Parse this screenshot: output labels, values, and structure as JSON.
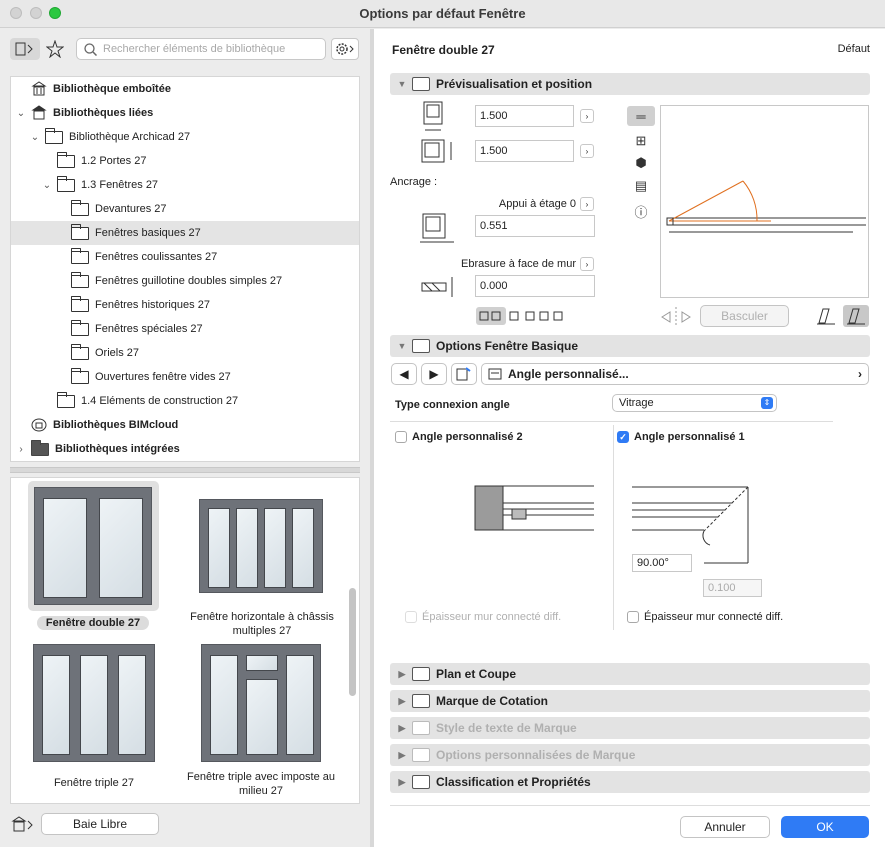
{
  "window": {
    "title": "Options par défaut Fenêtre"
  },
  "left": {
    "search_placeholder": "Rechercher éléments de bibliothèque",
    "tree": [
      {
        "label": "Bibliothèque emboîtée",
        "bold": true
      },
      {
        "label": "Bibliothèques liées",
        "bold": true
      },
      {
        "label": "Bibliothèque Archicad 27"
      },
      {
        "label": "1.2 Portes 27"
      },
      {
        "label": "1.3 Fenêtres 27"
      },
      {
        "label": "Devantures 27"
      },
      {
        "label": "Fenêtres basiques 27"
      },
      {
        "label": "Fenêtres coulissantes 27"
      },
      {
        "label": "Fenêtres guillotine doubles simples 27"
      },
      {
        "label": "Fenêtres historiques 27"
      },
      {
        "label": "Fenêtres spéciales 27"
      },
      {
        "label": "Oriels 27"
      },
      {
        "label": "Ouvertures fenêtre vides 27"
      },
      {
        "label": "1.4 Eléments de construction 27"
      },
      {
        "label": "Bibliothèques BIMcloud",
        "bold": true
      },
      {
        "label": "Bibliothèques intégrées",
        "bold": true
      }
    ],
    "gallery": [
      {
        "name": "Fenêtre double 27"
      },
      {
        "name": "Fenêtre horizontale à châssis multiples 27"
      },
      {
        "name": "Fenêtre triple 27"
      },
      {
        "name": "Fenêtre triple avec imposte au milieu 27"
      }
    ],
    "bottom_button": "Baie Libre"
  },
  "right": {
    "object_name": "Fenêtre double 27",
    "default_label": "Défaut",
    "preview_section": "Prévisualisation et position",
    "width_value": "1.500",
    "height_value": "1.500",
    "anchor_label": "Ancrage :",
    "sill_label": "Appui à étage 0",
    "sill_value": "0.551",
    "reveal_label": "Ebrasure à face de mur",
    "reveal_value": "0.000",
    "flip_button": "Basculer",
    "options_section": "Options Fenêtre Basique",
    "page_select": "Angle personnalisé...",
    "corner_type_label": "Type connexion angle",
    "corner_type_value": "Vitrage",
    "angle2_label": "Angle personnalisé 2",
    "angle1_label": "Angle personnalisé 1",
    "angle1_checked": true,
    "angle_value": "90.00°",
    "offset_value": "0.100",
    "thickness_left": "Épaisseur mur connecté diff.",
    "thickness_right": "Épaisseur mur connecté diff.",
    "sections": [
      {
        "label": "Plan et Coupe",
        "enabled": true
      },
      {
        "label": "Marque de Cotation",
        "enabled": true
      },
      {
        "label": "Style de texte de Marque",
        "enabled": false
      },
      {
        "label": "Options personnalisées de Marque",
        "enabled": false
      },
      {
        "label": "Classification et Propriétés",
        "enabled": true
      }
    ],
    "cancel": "Annuler",
    "ok": "OK"
  }
}
